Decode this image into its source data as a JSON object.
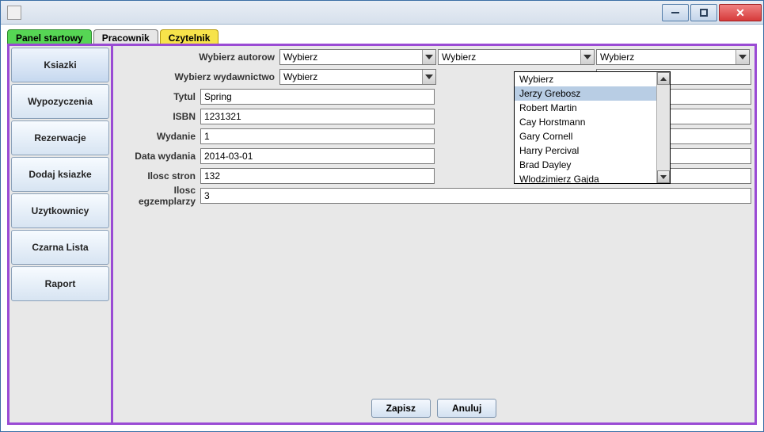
{
  "tabs": {
    "panel_startowy": "Panel startowy",
    "pracownik": "Pracownik",
    "czytelnik": "Czytelnik"
  },
  "sidebar": {
    "items": [
      "Ksiazki",
      "Wypozyczenia",
      "Rezerwacje",
      "Dodaj ksiazke",
      "Uzytkownicy",
      "Czarna Lista",
      "Raport"
    ]
  },
  "form": {
    "labels": {
      "wybierz_autorow": "Wybierz autorow",
      "wybierz_wydawnictwo": "Wybierz wydawnictwo",
      "tytul": "Tytul",
      "isbn": "ISBN",
      "wydanie": "Wydanie",
      "data_wydania": "Data wydania",
      "ilosc_stron": "Ilosc stron",
      "ilosc_egzemplarzy": "Ilosc egzemplarzy"
    },
    "values": {
      "tytul": "Spring",
      "isbn": "1231321",
      "wydanie": "1",
      "data_wydania": "2014-03-01",
      "ilosc_stron": "132",
      "ilosc_egzemplarzy": "3"
    },
    "combo_placeholder": "Wybierz",
    "author_dropdown": [
      "Wybierz",
      "Jerzy Grebosz",
      "Robert Martin",
      "Cay Horstmann",
      "Gary Cornell",
      "Harry Percival",
      "Brad Dayley",
      "Wlodzimierz Gajda"
    ],
    "author_dropdown_selected_index": 1
  },
  "buttons": {
    "zapisz": "Zapisz",
    "anuluj": "Anuluj"
  }
}
